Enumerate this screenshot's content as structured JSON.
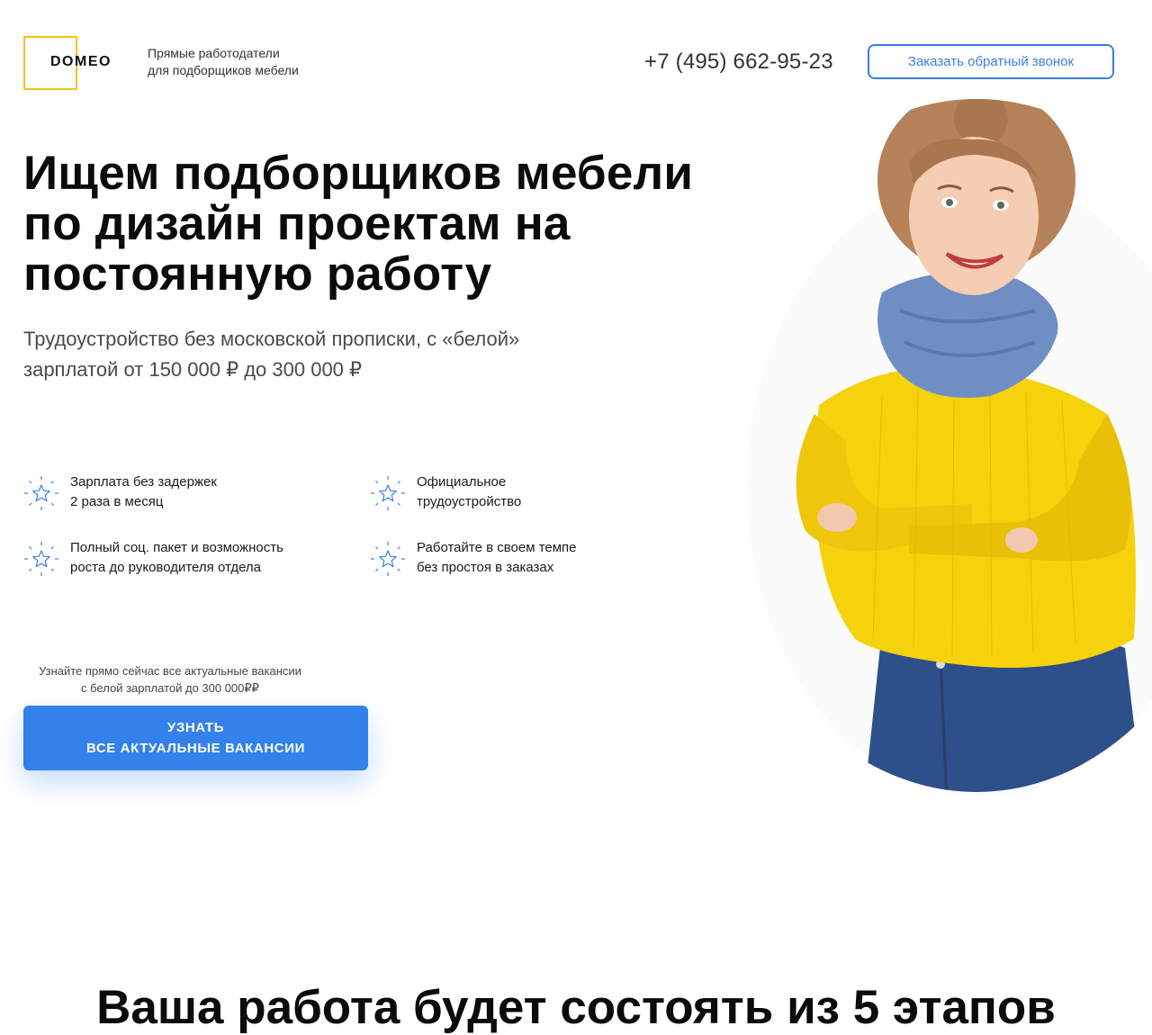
{
  "header": {
    "logo_text": "DOMEO",
    "tagline_line1": "Прямые работодатели",
    "tagline_line2": "для подборщиков мебели",
    "phone": "+7 (495) 662-95-23",
    "callback_label": "Заказать обратный звонок"
  },
  "hero": {
    "title_line1": "Ищем подборщиков мебели",
    "title_line2": "по дизайн проектам на",
    "title_line3": "постоянную работу",
    "subtitle_line1": "Трудоустройство без московской прописки, с «белой»",
    "subtitle_line2": "зарплатой от 150 000 ₽ до 300 000 ₽"
  },
  "features": [
    {
      "icon": "star-icon",
      "line1": "Зарплата без задержек",
      "line2": "2 раза в месяц"
    },
    {
      "icon": "star-icon",
      "line1": "Официальное",
      "line2": "трудоустройство"
    },
    {
      "icon": "star-icon",
      "line1": "Полный соц. пакет и возможность",
      "line2": "роста до руководителя отдела"
    },
    {
      "icon": "star-icon",
      "line1": "Работайте в своем темпе",
      "line2": "без простоя в заказах"
    }
  ],
  "cta": {
    "note_line1": "Узнайте прямо сейчас все актуальные вакансии",
    "note_line2": "с белой зарплатой до 300 000₽₽",
    "button_line1": "УЗНАТЬ",
    "button_line2": "ВСЕ АКТУАЛЬНЫЕ ВАКАНСИИ"
  },
  "next_section": {
    "title": "Ваша работа будет состоять из 5 этапов"
  },
  "colors": {
    "accent_blue": "#3381ea",
    "logo_yellow": "#f3c316",
    "sweater_yellow": "#f6d20c",
    "scarf_blue": "#6f8fc4",
    "jeans_blue": "#2d4f8a"
  }
}
